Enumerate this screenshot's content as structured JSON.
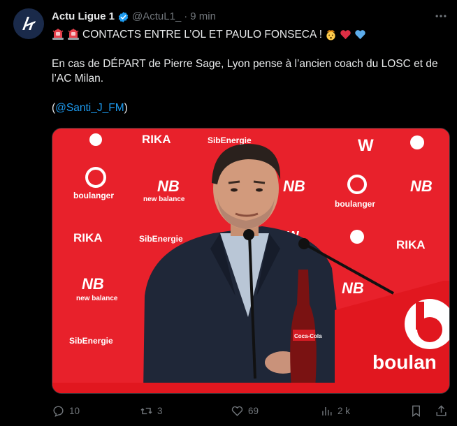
{
  "tweet": {
    "display_name": "Actu Ligue 1",
    "handle": "@ActuL1_",
    "separator": "·",
    "time": "9 min",
    "verified_icon": "verified-badge-icon",
    "headline": "CONTACTS ENTRE L’OL ET PAULO FONSECA !",
    "body_line": "En cas de DÉPART de Pierre Sage, Lyon pense à l’ancien coach du LOSC et de l’AC Milan.",
    "mention_open": "(",
    "mention": "@Santi_J_FM",
    "mention_close": ")",
    "emojis": [
      "police-light-icon",
      "police-light-icon",
      "exploding-head-icon",
      "red-heart-icon",
      "blue-heart-icon"
    ]
  },
  "media": {
    "alt": "Press conference photo",
    "sponsor_rika": "RIKA",
    "sponsor_boulanger": "boulanger",
    "sponsor_nb": "new balance",
    "sponsor_sibe": "SibEnergie",
    "bottle_label": "Coca-Cola",
    "desk_sign": "boulan"
  },
  "actions": {
    "replies": "10",
    "reposts": "3",
    "likes": "69",
    "views": "2 k"
  },
  "colors": {
    "background": "#000000",
    "text": "#e7e9ea",
    "muted": "#71767b",
    "link": "#1d9bf0",
    "backdrop_red": "#e8212b"
  }
}
